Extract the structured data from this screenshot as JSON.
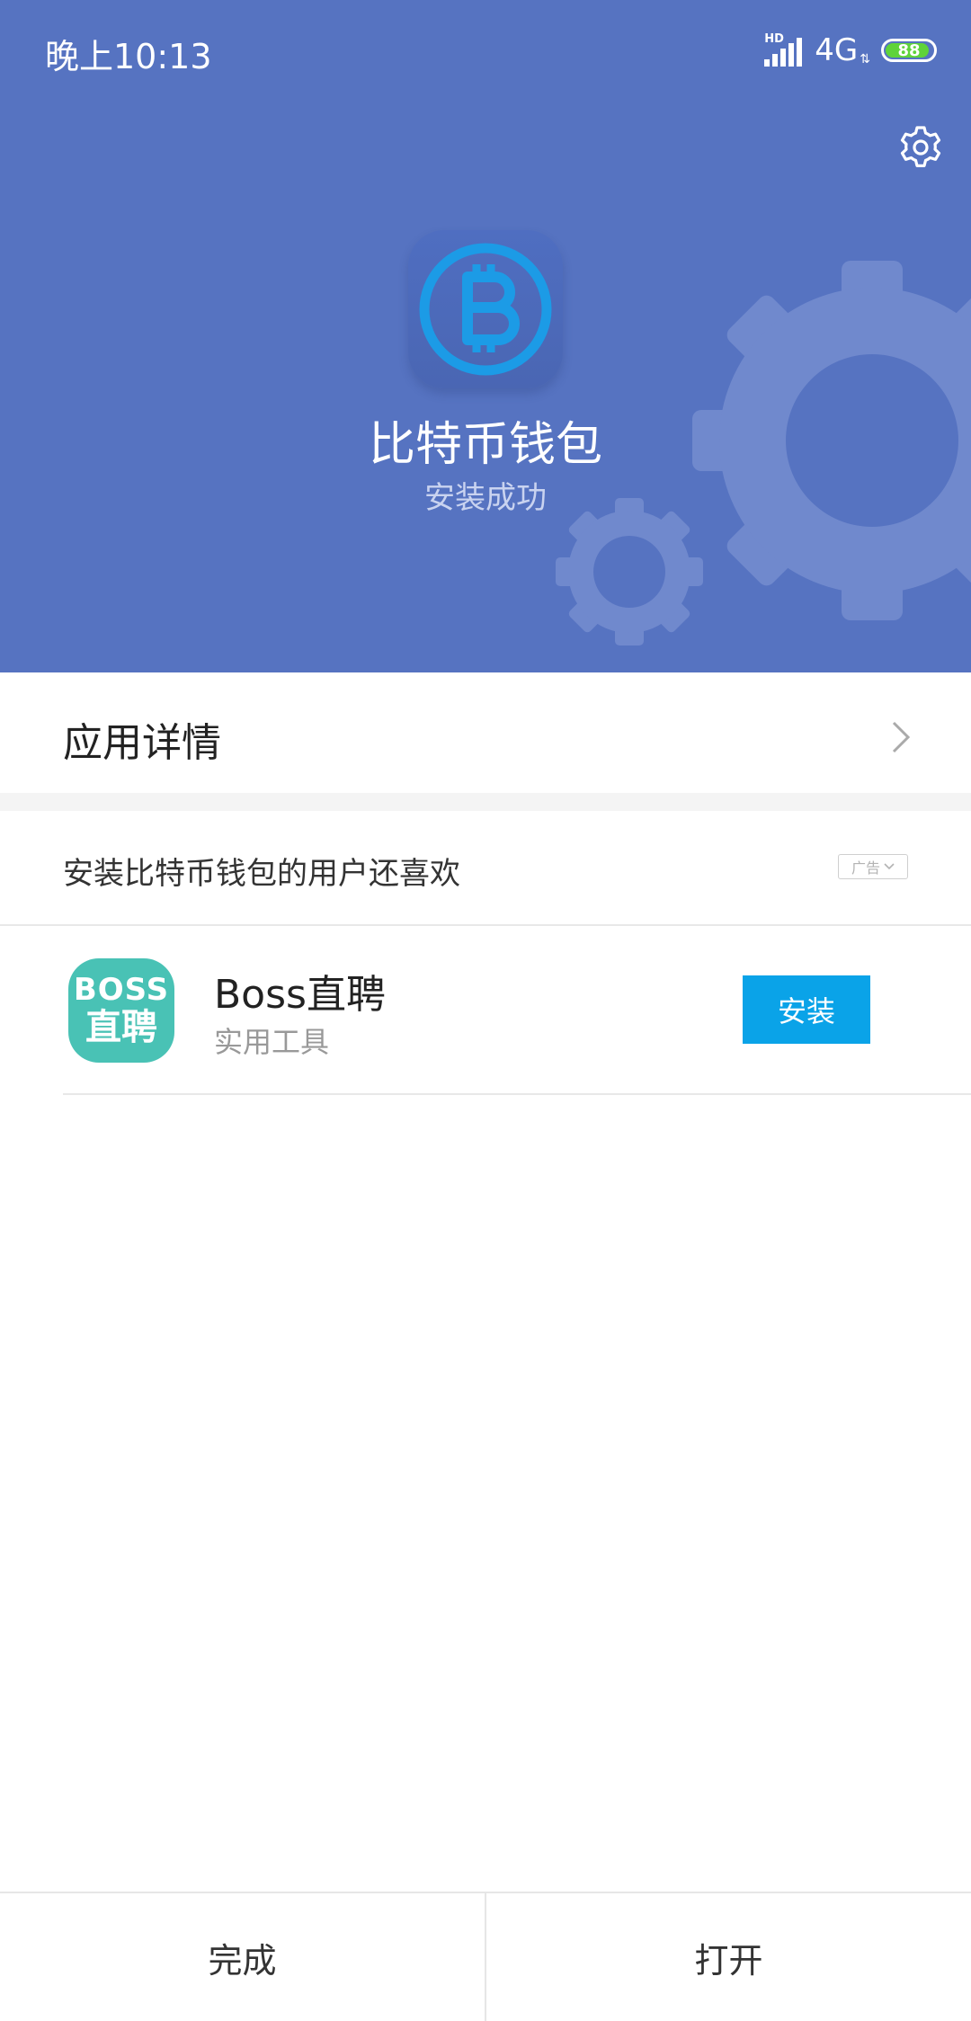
{
  "status_bar": {
    "time": "晚上10:13",
    "hd_label": "HD",
    "network": "4G",
    "battery_level": "88"
  },
  "header": {
    "app_name": "比特币钱包",
    "install_status": "安装成功",
    "settings_icon": "gear-icon",
    "app_icon": "bitcoin-icon"
  },
  "details": {
    "label": "应用详情"
  },
  "recommend": {
    "title": "安装比特币钱包的用户还喜欢",
    "ad_label": "广告",
    "items": [
      {
        "icon_line1": "BOSS",
        "icon_line2": "直聘",
        "name": "Boss直聘",
        "category": "实用工具",
        "button": "安装"
      }
    ]
  },
  "bottom_bar": {
    "done": "完成",
    "open": "打开"
  },
  "colors": {
    "header_bg": "#5673c1",
    "install_button": "#0aa3e8",
    "boss_icon": "#49c2b5",
    "bitcoin_blue": "#1c9be6",
    "battery_green": "#5fd33a"
  }
}
